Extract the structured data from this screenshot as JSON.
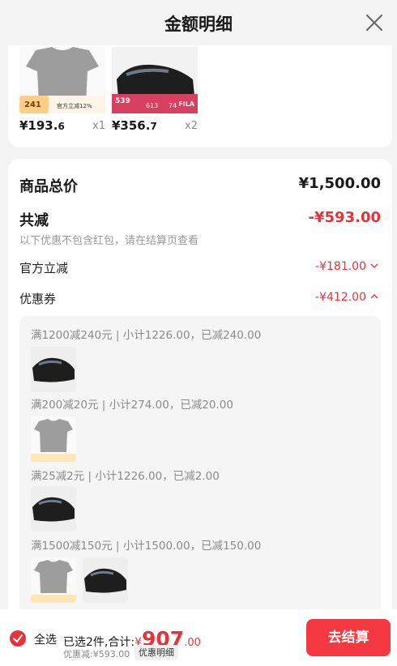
{
  "header": {
    "title": "金额明细"
  },
  "products": [
    {
      "price_main": "¥193.",
      "price_dec": "6",
      "qty": "x1",
      "tag_price": "241",
      "tag_text": "官方立减12%"
    },
    {
      "price_main": "¥356.",
      "price_dec": "7",
      "qty": "x2",
      "tag_price": "539",
      "tag_price2": "613",
      "tag_price3": "74",
      "brand": "FILA"
    }
  ],
  "summary": {
    "total_label": "商品总价",
    "total_value": "¥1,500.00",
    "reduce_label": "共减",
    "reduce_value": "-¥593.00",
    "reduce_note": "以下优惠不包含红包，请在结算页查看",
    "official_label": "官方立减",
    "official_value": "-¥181.00",
    "coupon_label": "优惠券",
    "coupon_value": "-¥412.00"
  },
  "coupons": [
    {
      "text": "满1200减240元 | 小计1226.00，已减240.00"
    },
    {
      "text": "满200减20元 | 小计274.00，已减20.00"
    },
    {
      "text": "满25减2元 | 小计1226.00，已减2.00"
    },
    {
      "text": "满1500减150元 | 小计1500.00，已减150.00"
    }
  ],
  "bottom": {
    "select_all": "全选",
    "selected_text": "已选2件,合计:",
    "currency": "¥",
    "amount_int": "907",
    "amount_dec": ".00",
    "discount_text": "优惠减:¥593.00",
    "detail_label": "优惠明细",
    "checkout_label": "去结算"
  },
  "colors": {
    "accent": "#e8323a",
    "checkout": "#f53842"
  }
}
